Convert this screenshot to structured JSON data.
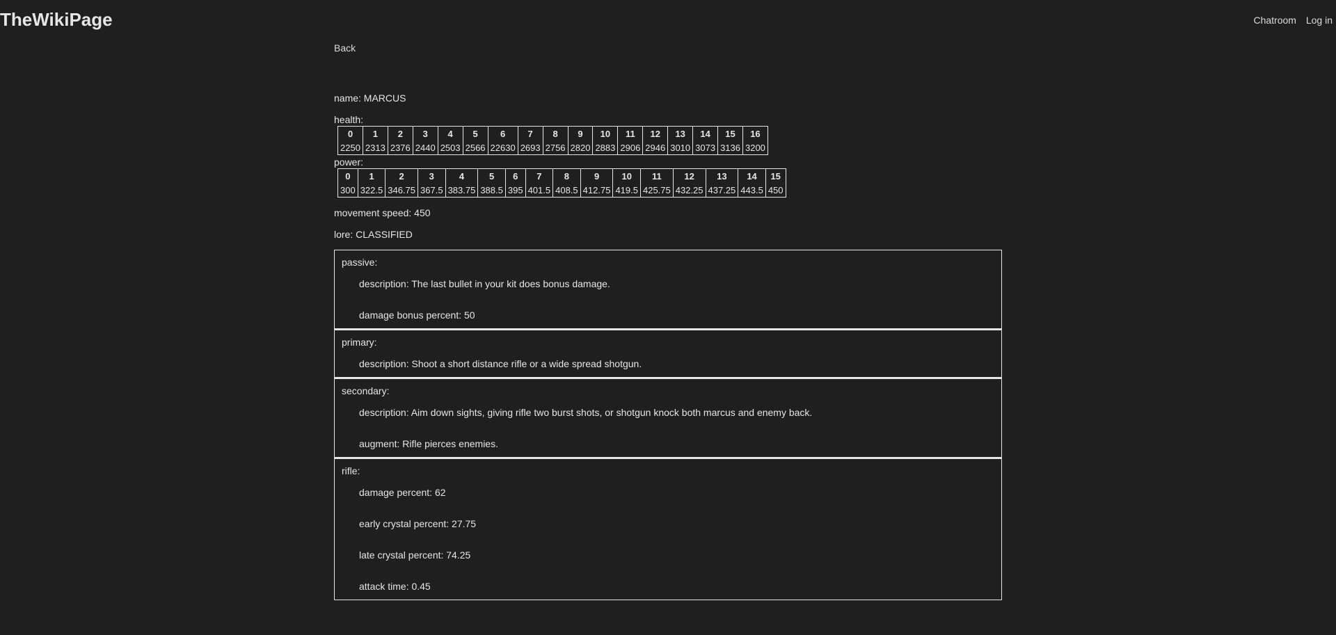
{
  "header": {
    "site_title": "TheWikiPage",
    "nav": [
      "Chatroom",
      "Log in"
    ]
  },
  "back_label": "Back",
  "character": {
    "name_line": "name: MARCUS",
    "health_label": "health:",
    "health": {
      "levels": [
        "0",
        "1",
        "2",
        "3",
        "4",
        "5",
        "6",
        "7",
        "8",
        "9",
        "10",
        "11",
        "12",
        "13",
        "14",
        "15",
        "16"
      ],
      "values": [
        "2250",
        "2313",
        "2376",
        "2440",
        "2503",
        "2566",
        "22630",
        "2693",
        "2756",
        "2820",
        "2883",
        "2906",
        "2946",
        "3010",
        "3073",
        "3136",
        "3200"
      ]
    },
    "power_label": "power:",
    "power": {
      "levels": [
        "0",
        "1",
        "2",
        "3",
        "4",
        "5",
        "6",
        "7",
        "8",
        "9",
        "10",
        "11",
        "12",
        "13",
        "14",
        "15"
      ],
      "values": [
        "300",
        "322.5",
        "346.75",
        "367.5",
        "383.75",
        "388.5",
        "395",
        "401.5",
        "408.5",
        "412.75",
        "419.5",
        "425.75",
        "432.25",
        "437.25",
        "443.5",
        "450"
      ]
    },
    "movement_line": "movement speed: 450",
    "lore_line": "lore: CLASSIFIED"
  },
  "abilities": [
    {
      "title": "passive:",
      "props": [
        "description: The last bullet in your kit does bonus damage.",
        "damage bonus percent: 50"
      ]
    },
    {
      "title": "primary:",
      "props": [
        "description: Shoot a short distance rifle or a wide spread shotgun."
      ]
    },
    {
      "title": "secondary:",
      "props": [
        "description: Aim down sights, giving rifle two burst shots, or shotgun knock both marcus and enemy back.",
        "augment: Rifle pierces enemies."
      ]
    },
    {
      "title": "rifle:",
      "props": [
        "damage percent: 62",
        "early crystal percent: 27.75",
        "late crystal percent: 74.25",
        "attack time: 0.45"
      ]
    }
  ]
}
